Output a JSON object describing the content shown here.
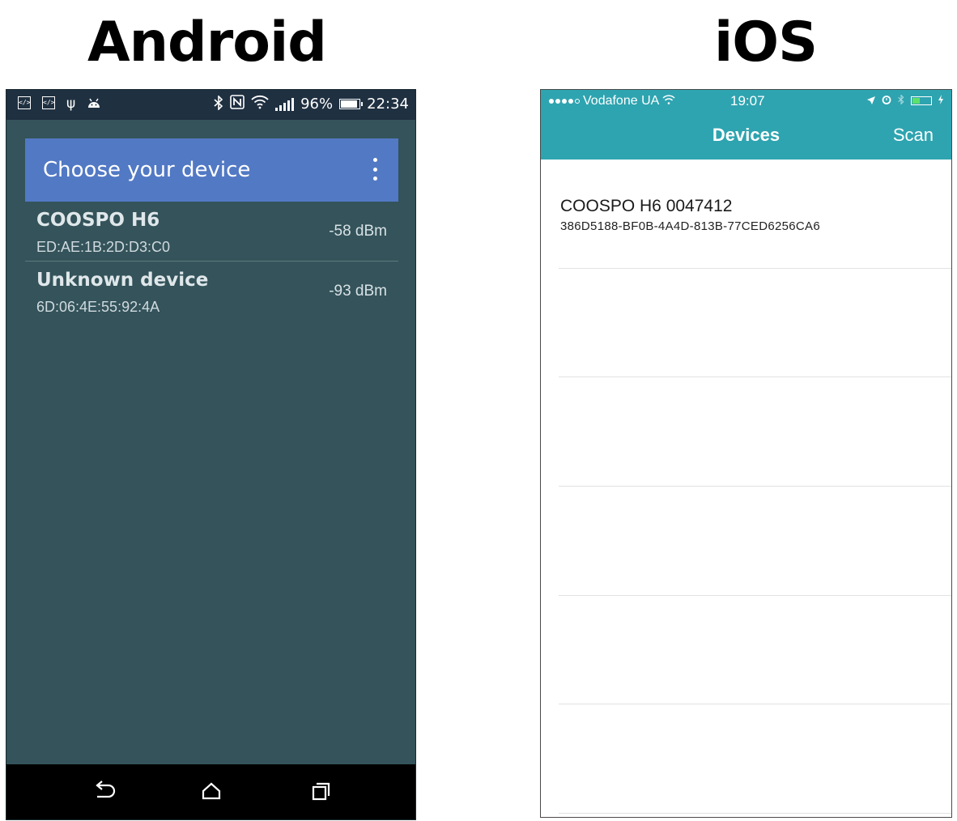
{
  "headings": {
    "android": "Android",
    "ios": "iOS"
  },
  "android": {
    "status_bar": {
      "left_icons": [
        "code-icon",
        "code-icon",
        "usb-icon",
        "android-icon"
      ],
      "right_icons": [
        "bluetooth-icon",
        "nfc-icon",
        "wifi-icon",
        "signal-icon"
      ],
      "battery": "96%",
      "battery_level": 0.96,
      "time": "22:34"
    },
    "dialog": {
      "title": "Choose your device",
      "menu_icon": "more-vertical-icon"
    },
    "devices": [
      {
        "name": "COOSPO H6",
        "address": "ED:AE:1B:2D:D3:C0",
        "rssi": "-58 dBm"
      },
      {
        "name": "Unknown device",
        "address": "6D:06:4E:55:92:4A",
        "rssi": "-93 dBm"
      }
    ],
    "nav_bar": [
      "back-icon",
      "home-icon",
      "recents-icon"
    ],
    "colors": {
      "status_bar": "#1f3041",
      "background": "#34535a",
      "dialog_header": "#5279c4",
      "nav_bar": "#000000"
    }
  },
  "ios": {
    "status_bar": {
      "carrier": "Vodafone UA",
      "time": "19:07",
      "right_icons": [
        "location-icon",
        "alarm-icon",
        "bluetooth-icon",
        "battery-icon",
        "charging-icon"
      ],
      "battery_level": 0.4
    },
    "nav": {
      "title": "Devices",
      "scan_button": "Scan"
    },
    "devices": [
      {
        "name": "COOSPO H6 0047412",
        "uuid": "386D5188-BF0B-4A4D-813B-77CED6256CA6"
      }
    ],
    "colors": {
      "nav_bar": "#2ea4b0",
      "background": "#ffffff"
    }
  }
}
